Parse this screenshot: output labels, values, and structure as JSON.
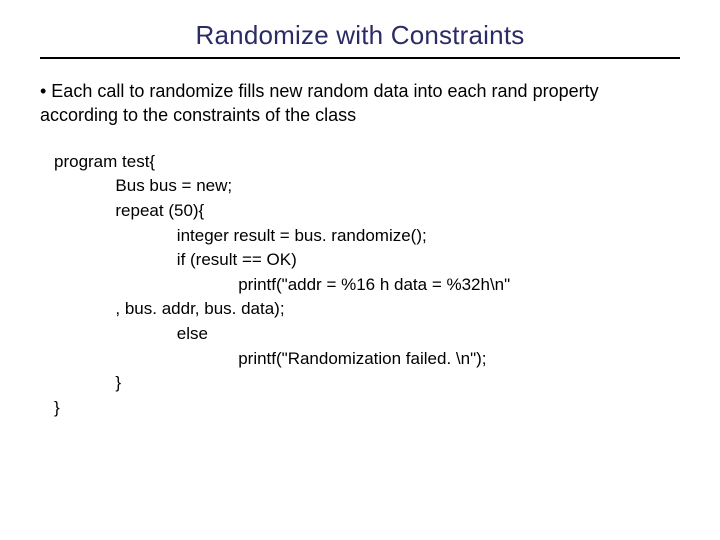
{
  "title": "Randomize with Constraints",
  "bullet": "• Each call to randomize fills new random data into each rand property according to the constraints of the class",
  "code": "program test{\n             Bus bus = new;\n             repeat (50){\n                          integer result = bus. randomize();\n                          if (result == OK)\n                                       printf(\"addr = %16 h data = %32h\\n\"\n             , bus. addr, bus. data);\n                          else\n                                       printf(\"Randomization failed. \\n\");\n             }\n}"
}
